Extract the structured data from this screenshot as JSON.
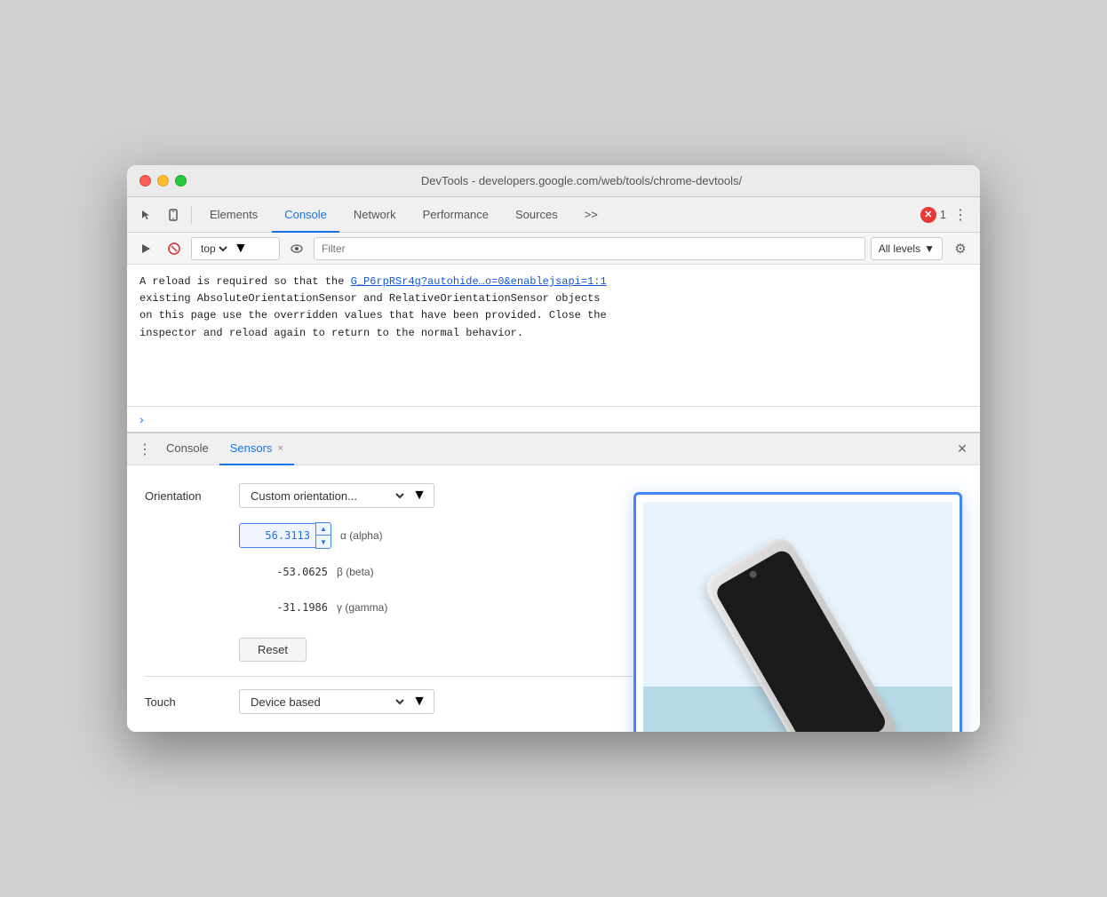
{
  "window": {
    "title": "DevTools - developers.google.com/web/tools/chrome-devtools/"
  },
  "toolbar": {
    "tabs": [
      {
        "id": "elements",
        "label": "Elements",
        "active": false
      },
      {
        "id": "console",
        "label": "Console",
        "active": true
      },
      {
        "id": "network",
        "label": "Network",
        "active": false
      },
      {
        "id": "performance",
        "label": "Performance",
        "active": false
      },
      {
        "id": "sources",
        "label": "Sources",
        "active": false
      }
    ],
    "more_label": ">>",
    "error_count": "1"
  },
  "console_toolbar": {
    "context": "top",
    "filter_placeholder": "Filter",
    "levels_label": "All levels",
    "eye_label": "👁"
  },
  "console_output": {
    "message": "A reload is required so that the",
    "link_text": "G_P6rpRSr4g?autohide…o=0&enablejsapi=1:1",
    "message2": "existing AbsoluteOrientationSensor and RelativeOrientationSensor objects",
    "message3": "on this page use the overridden values that have been provided. Close the",
    "message4": "inspector and reload again to return to the normal behavior."
  },
  "bottom_panel": {
    "tabs": [
      {
        "id": "console",
        "label": "Console",
        "closeable": false,
        "active": false
      },
      {
        "id": "sensors",
        "label": "Sensors",
        "closeable": true,
        "active": true
      }
    ],
    "close_label": "×"
  },
  "sensors": {
    "orientation_label": "Orientation",
    "orientation_dropdown": "Custom orientation...",
    "alpha_value": "56.3113",
    "alpha_label": "α (alpha)",
    "beta_value": "-53.0625",
    "beta_label": "β (beta)",
    "gamma_value": "-31.1986",
    "gamma_label": "γ (gamma)",
    "reset_label": "Reset",
    "touch_label": "Touch",
    "touch_dropdown": "Device based"
  }
}
